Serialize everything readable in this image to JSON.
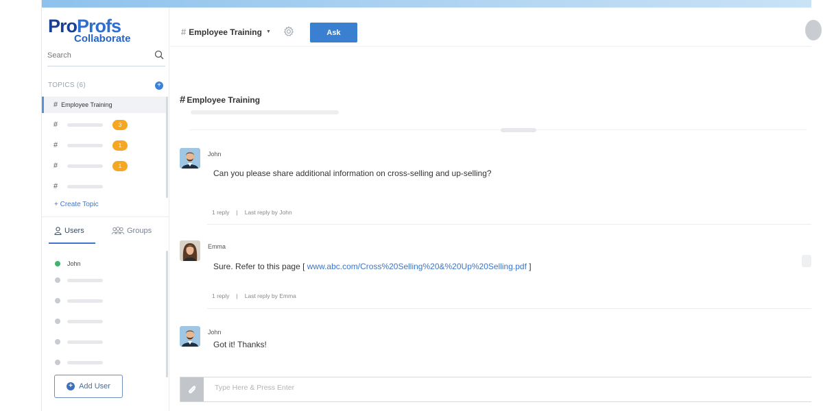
{
  "logo": {
    "line1a": "Pro",
    "line1b": "Profs",
    "line2": "Collaborate"
  },
  "search": {
    "placeholder": "Search"
  },
  "topics": {
    "header": "TOPICS (6)",
    "active": "Employee Training",
    "badges": [
      "3",
      "1",
      "1"
    ],
    "create_label": "+ Create Topic"
  },
  "tabs": {
    "users": "Users",
    "groups": "Groups"
  },
  "users": {
    "online_name": "John"
  },
  "add_user_label": "Add User",
  "header": {
    "channel": "Employee Training",
    "ask_label": "Ask"
  },
  "channel": {
    "title": "Employee Training"
  },
  "messages": [
    {
      "author": "John",
      "text": "Can you please share additional information on cross-selling and up-selling?",
      "reply_count": "1 reply",
      "divider": "|",
      "last_reply": "Last reply by",
      "last_reply_by": "John"
    },
    {
      "author": "Emma",
      "text_before": "Sure. Refer to this page [",
      "link": "www.abc.com/Cross%20Selling%20&%20Up%20Selling.pdf",
      "text_after": "]",
      "reply_count": "1 reply",
      "divider": "|",
      "last_reply": "Last reply by",
      "last_reply_by": "Emma"
    },
    {
      "author": "John",
      "text": "Got it! Thanks!"
    }
  ],
  "composer": {
    "placeholder": "Type Here & Press Enter"
  },
  "colors": {
    "accent": "#3b7fd0",
    "badge": "#f5a623",
    "online": "#3fb56b",
    "topbar": "#8ec2ec"
  }
}
